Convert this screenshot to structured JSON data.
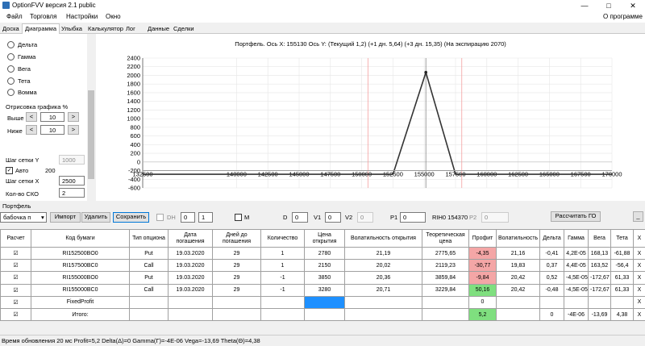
{
  "window": {
    "title": "OptionFVV версия 2.1 public",
    "minimize": "—",
    "maximize": "□",
    "close": "✕"
  },
  "menu": {
    "file": "Файл",
    "trade": "Торговля",
    "settings": "Настройки",
    "window": "Окно",
    "about": "О программе"
  },
  "tabs": [
    "Доска",
    "Диаграмма",
    "Улыбка",
    "Калькулятор",
    "Лог",
    "Данные",
    "Сделки"
  ],
  "left_panel": {
    "radios": [
      "Дельта",
      "Гамма",
      "Вега",
      "Тета",
      "Вомма"
    ],
    "draw_title": "Отрисовка графика %",
    "above_label": "Выше",
    "above_value": "10",
    "below_label": "Ниже",
    "below_value": "10",
    "minus": "<",
    "plus": ">",
    "grid_y_label": "Шаг сетки Y",
    "grid_y_value": "1000",
    "auto_label": "Авто",
    "auto_value": "200",
    "grid_x_label": "Шаг сетки X",
    "grid_x_value": "2500",
    "sko_label": "Кол-во СКО",
    "sko_value": "2"
  },
  "chart_data": {
    "type": "line",
    "title": "Портфель. Ось X: 155130 Ось Y:  (Текущий 1,2)  (+1 дн. 5,64)  (+3 дн. 15,35)  (На экспирацию 2070)",
    "xlim": [
      132500,
      170000
    ],
    "ylim": [
      -600,
      2400
    ],
    "x_ticks": [
      "132500",
      "140000",
      "142500",
      "145000",
      "147500",
      "150000",
      "152500",
      "155000",
      "157500",
      "160000",
      "162500",
      "165000",
      "167500",
      "170000"
    ],
    "y_ticks": [
      "2400",
      "2200",
      "2000",
      "1800",
      "1600",
      "1400",
      "1200",
      "1000",
      "800",
      "600",
      "400",
      "200",
      "0",
      "-200",
      "-400",
      "-600"
    ],
    "cursor_x": 155130,
    "red_lines_x": [
      150500,
      158000
    ],
    "series": [
      {
        "x": [
          132500,
          152500,
          155130,
          157500,
          170000
        ],
        "y": [
          -285,
          -285,
          2070,
          -285,
          -285
        ],
        "color": "#333333"
      },
      {
        "x": [
          132500,
          170000
        ],
        "y": [
          -200,
          -200
        ],
        "color": "#999999"
      }
    ]
  },
  "portfolio_label": "Портфель",
  "controls": {
    "portfolio_select": "бабочка п",
    "import": "Импорт",
    "delete": "Удалить",
    "save": "Сохранить",
    "dh_label": "DH",
    "dh_a": "0",
    "dh_b": "1",
    "m_label": "M",
    "d_label": "D",
    "d_value": "0",
    "v1_label": "V1",
    "v1_value": "0",
    "v2_label": "V2",
    "v2_value": "0",
    "p1_label": "P1",
    "p1_value": "0",
    "rih_label": "RIH0 154370",
    "p2_label": "P2",
    "p2_value": "0",
    "calc_go": "Рассчитать ГО",
    "minimize": "_"
  },
  "table": {
    "headers": [
      "Расчет",
      "Код бумаги",
      "Тип опциона",
      "Дата погашения",
      "Дней до погашения",
      "Количество",
      "Цена открытия",
      "Волатильность открытия",
      "Теоретическая цена",
      "Профит",
      "Волатильность",
      "Дельта",
      "Гамма",
      "Вега",
      "Тета",
      "X"
    ],
    "rows": [
      {
        "check": "☑",
        "code": "RI152500BO0",
        "type": "Put",
        "date": "19.03.2020",
        "days": "29",
        "qty": "1",
        "price": "2780",
        "vol_open": "21,19",
        "theo": "2775,65",
        "profit": "-4,35",
        "vol": "21,16",
        "delta": "-0,41",
        "gamma": "4,2E-05",
        "vega": "168,13",
        "theta": "-61,88",
        "x": "X"
      },
      {
        "check": "☑",
        "code": "RI157500BC0",
        "type": "Call",
        "date": "19.03.2020",
        "days": "29",
        "qty": "1",
        "price": "2150",
        "vol_open": "20,02",
        "theo": "2119,23",
        "profit": "-30,77",
        "vol": "19,83",
        "delta": "0,37",
        "gamma": "4,4E-05",
        "vega": "163,52",
        "theta": "-56,4",
        "x": "X"
      },
      {
        "check": "☑",
        "code": "RI155000BO0",
        "type": "Put",
        "date": "19.03.2020",
        "days": "29",
        "qty": "-1",
        "price": "3850",
        "vol_open": "20,36",
        "theo": "3859,84",
        "profit": "-9,84",
        "vol": "20,42",
        "delta": "0,52",
        "gamma": "-4,5E-05",
        "vega": "-172,67",
        "theta": "61,33",
        "x": "X"
      },
      {
        "check": "☑",
        "code": "RI155000BC0",
        "type": "Call",
        "date": "19.03.2020",
        "days": "29",
        "qty": "-1",
        "price": "3280",
        "vol_open": "20,71",
        "theo": "3229,84",
        "profit": "50,16",
        "vol": "20,42",
        "delta": "-0,48",
        "gamma": "-4,5E-05",
        "vega": "-172,67",
        "theta": "61,33",
        "x": "X"
      }
    ],
    "fixed": {
      "check": "☑",
      "label": "FixedProfit",
      "profit": "0",
      "x": "X"
    },
    "total": {
      "check": "☑",
      "label": "Итого:",
      "profit": "5,2",
      "delta": "0",
      "gamma": "-4E-06",
      "vega": "-13,69",
      "theta": "4,38",
      "x": "X"
    }
  },
  "status": "Время обновления 20 мс  Profit=5,2 Delta(Δ)=0 Gamma(Γ)=-4E-06 Vega=-13,69 Theta(Θ)=4,38"
}
